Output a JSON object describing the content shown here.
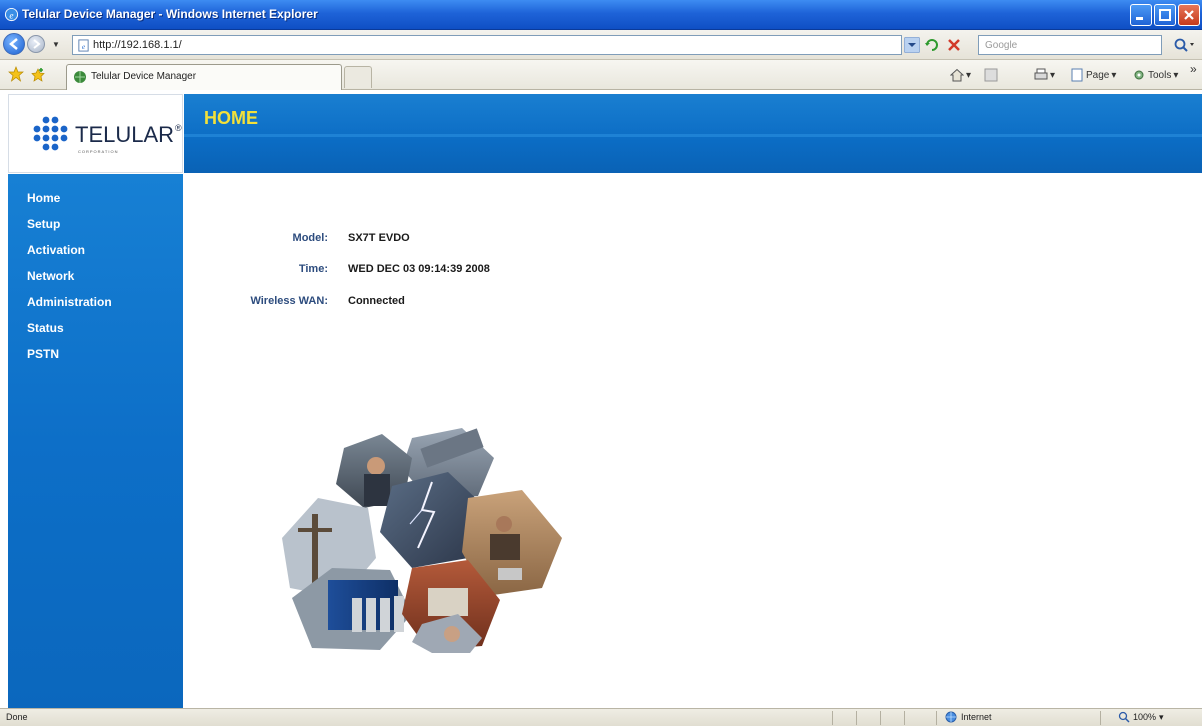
{
  "window": {
    "title": "Telular Device Manager - Windows Internet Explorer"
  },
  "address_bar": {
    "url": "http://192.168.1.1/",
    "search_placeholder": "Google"
  },
  "tabs": [
    {
      "label": "Telular Device Manager"
    }
  ],
  "command_bar": {
    "page_label": "Page",
    "tools_label": "Tools"
  },
  "logo": {
    "text": "TELULAR",
    "mark": "®",
    "subtext": "CORPORATION"
  },
  "header": {
    "title": "HOME"
  },
  "sidebar": {
    "items": [
      {
        "label": "Home"
      },
      {
        "label": "Setup"
      },
      {
        "label": "Activation"
      },
      {
        "label": "Network"
      },
      {
        "label": "Administration"
      },
      {
        "label": "Status"
      },
      {
        "label": "PSTN"
      }
    ]
  },
  "device_info": [
    {
      "label": "Model:",
      "value": "SX7T EVDO"
    },
    {
      "label": "Time:",
      "value": "WED DEC 03 09:14:39 2008"
    },
    {
      "label": "Wireless WAN:",
      "value": "Connected"
    }
  ],
  "status_bar": {
    "text": "Done",
    "zone": "Internet",
    "zoom": "100%"
  },
  "colors": {
    "brand_blue": "#0b6cc4",
    "title_yellow": "#f2e03a",
    "label_blue": "#2d4c7e",
    "titlebar_blue": "#1e63d8"
  }
}
